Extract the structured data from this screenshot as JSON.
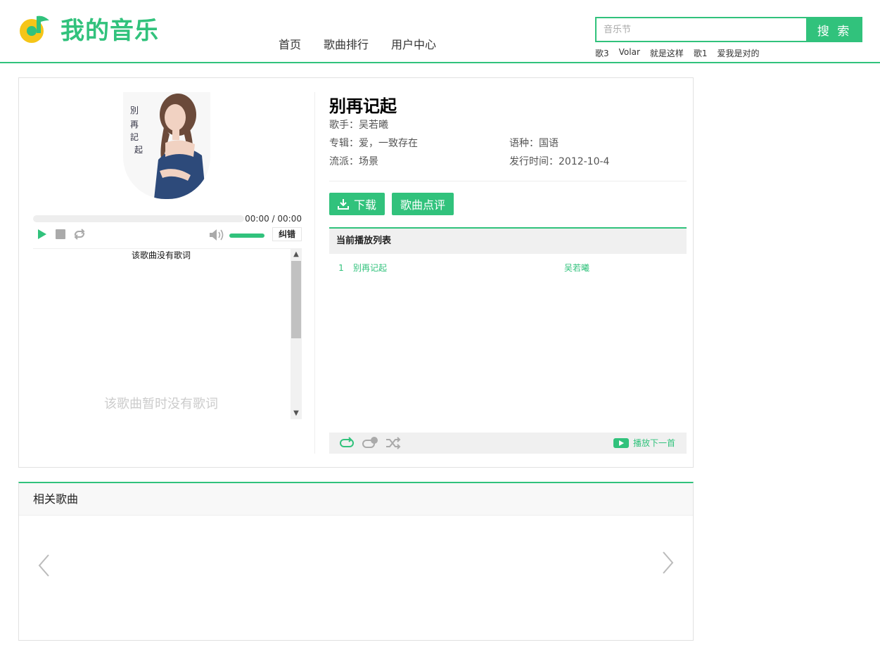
{
  "header": {
    "logo_text": "我的音乐",
    "nav": [
      "首页",
      "歌曲排行",
      "用户中心"
    ],
    "search_placeholder": "音乐节",
    "search_button": "搜 索",
    "hot_searches": [
      "歌3",
      "Volar",
      "就是这样",
      "歌1",
      "爱我是对的"
    ]
  },
  "player": {
    "cover_text": "別再記起",
    "time": "00:00 / 00:00",
    "progress": 0,
    "volume": 1,
    "report_button": "纠错",
    "lyric_top": "该歌曲没有歌词",
    "lyric_empty": "该歌曲暂时没有歌词"
  },
  "song": {
    "title": "别再记起",
    "singer": "歌手：吴若曦",
    "album": "专辑：爱，一致存在",
    "language": "语种：国语",
    "genre": "流派：场景",
    "release": "发行时间：2012-10-4",
    "download_button": "下载",
    "comment_button": "歌曲点评"
  },
  "playlist": {
    "header": "当前播放列表",
    "items": [
      {
        "num": "1",
        "name": "别再记起",
        "artist": "吴若曦"
      }
    ],
    "next_label": "播放下一首"
  },
  "related": {
    "title": "相关歌曲"
  },
  "colors": {
    "accent": "#31c27c",
    "logo_yellow": "#f5c518"
  }
}
